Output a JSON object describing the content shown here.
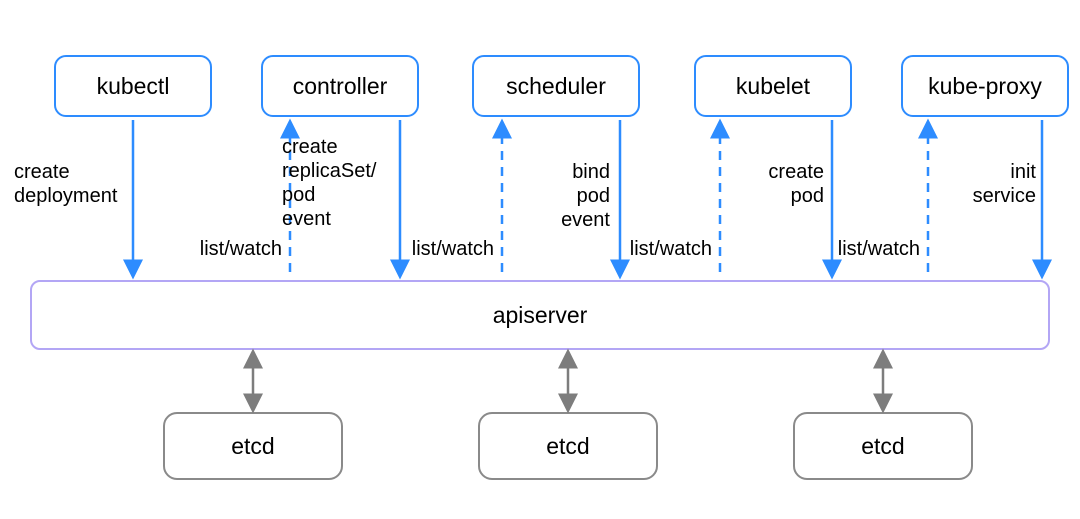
{
  "nodes": {
    "kubectl": "kubectl",
    "controller": "controller",
    "scheduler": "scheduler",
    "kubelet": "kubelet",
    "kubeproxy": "kube-proxy",
    "apiserver": "apiserver",
    "etcd1": "etcd",
    "etcd2": "etcd",
    "etcd3": "etcd"
  },
  "edge_labels": {
    "create_deployment": "create\ndeployment",
    "controller_up": "list/watch",
    "controller_down": "create\nreplicaSet/\npod\nevent",
    "scheduler_up": "list/watch",
    "scheduler_down": "bind\npod\nevent",
    "kubelet_up": "list/watch",
    "kubelet_down": "create\npod",
    "kubeproxy_up": "list/watch",
    "kubeproxy_down": "init\nservice"
  },
  "colors": {
    "blue": "#2d8cff",
    "purple": "#b3a6f5",
    "gray": "#7d7d7d"
  },
  "diagram_semantics": {
    "description": "Kubernetes control-plane dataflow: client components talk to the apiserver; apiserver persists state to an etcd cluster.",
    "edges": [
      {
        "from": "kubectl",
        "to": "apiserver",
        "label_key": "create_deployment",
        "style": "solid",
        "direction": "down"
      },
      {
        "from": "apiserver",
        "to": "controller",
        "label_key": "controller_up",
        "style": "dashed",
        "direction": "up"
      },
      {
        "from": "controller",
        "to": "apiserver",
        "label_key": "controller_down",
        "style": "solid",
        "direction": "down"
      },
      {
        "from": "apiserver",
        "to": "scheduler",
        "label_key": "scheduler_up",
        "style": "dashed",
        "direction": "up"
      },
      {
        "from": "scheduler",
        "to": "apiserver",
        "label_key": "scheduler_down",
        "style": "solid",
        "direction": "down"
      },
      {
        "from": "apiserver",
        "to": "kubelet",
        "label_key": "kubelet_up",
        "style": "dashed",
        "direction": "up"
      },
      {
        "from": "kubelet",
        "to": "apiserver",
        "label_key": "kubelet_down",
        "style": "solid",
        "direction": "down"
      },
      {
        "from": "apiserver",
        "to": "kubeproxy",
        "label_key": "kubeproxy_up",
        "style": "dashed",
        "direction": "up"
      },
      {
        "from": "kubeproxy",
        "to": "apiserver",
        "label_key": "kubeproxy_down",
        "style": "solid",
        "direction": "down"
      },
      {
        "from": "apiserver",
        "to": "etcd1",
        "style": "solid",
        "direction": "both"
      },
      {
        "from": "apiserver",
        "to": "etcd2",
        "style": "solid",
        "direction": "both"
      },
      {
        "from": "apiserver",
        "to": "etcd3",
        "style": "solid",
        "direction": "both"
      }
    ]
  }
}
